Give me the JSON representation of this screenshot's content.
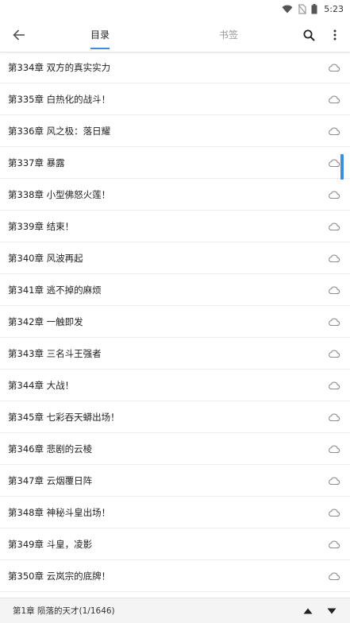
{
  "status_bar": {
    "time": "5:23",
    "icons": [
      "wifi-icon",
      "no-sim-icon",
      "battery-icon"
    ]
  },
  "toolbar": {
    "tabs": [
      {
        "label": "目录",
        "active": true
      },
      {
        "label": "书签",
        "active": false
      }
    ],
    "icons": [
      "back-arrow-icon",
      "search-icon",
      "more-vertical-icon"
    ]
  },
  "chapters": [
    {
      "title": "第334章 双方的真实实力"
    },
    {
      "title": "第335章 白热化的战斗！"
    },
    {
      "title": "第336章 风之极：落日耀"
    },
    {
      "title": "第337章 暴露"
    },
    {
      "title": "第338章 小型佛怒火莲！"
    },
    {
      "title": "第339章 结束！"
    },
    {
      "title": "第340章 风波再起"
    },
    {
      "title": "第341章 逃不掉的麻烦"
    },
    {
      "title": "第342章 一触即发"
    },
    {
      "title": "第343章 三名斗王强者"
    },
    {
      "title": "第344章 大战！"
    },
    {
      "title": "第345章 七彩吞天蟒出场！"
    },
    {
      "title": "第346章 悲剧的云棱"
    },
    {
      "title": "第347章 云烟覆日阵"
    },
    {
      "title": "第348章 神秘斗皇出场！"
    },
    {
      "title": "第349章 斗皇，凌影"
    },
    {
      "title": "第350章 云岚宗的底牌！"
    }
  ],
  "chapter_icon": "cloud-icon",
  "bottom_bar": {
    "current_chapter": "第1章 陨落的天才(1/1646)",
    "icons": [
      "arrow-up-icon",
      "arrow-down-icon"
    ]
  },
  "colors": {
    "accent": "#3a8de0",
    "text": "#222222",
    "muted": "#9a9a9a",
    "icon": "#8a8a8a"
  }
}
